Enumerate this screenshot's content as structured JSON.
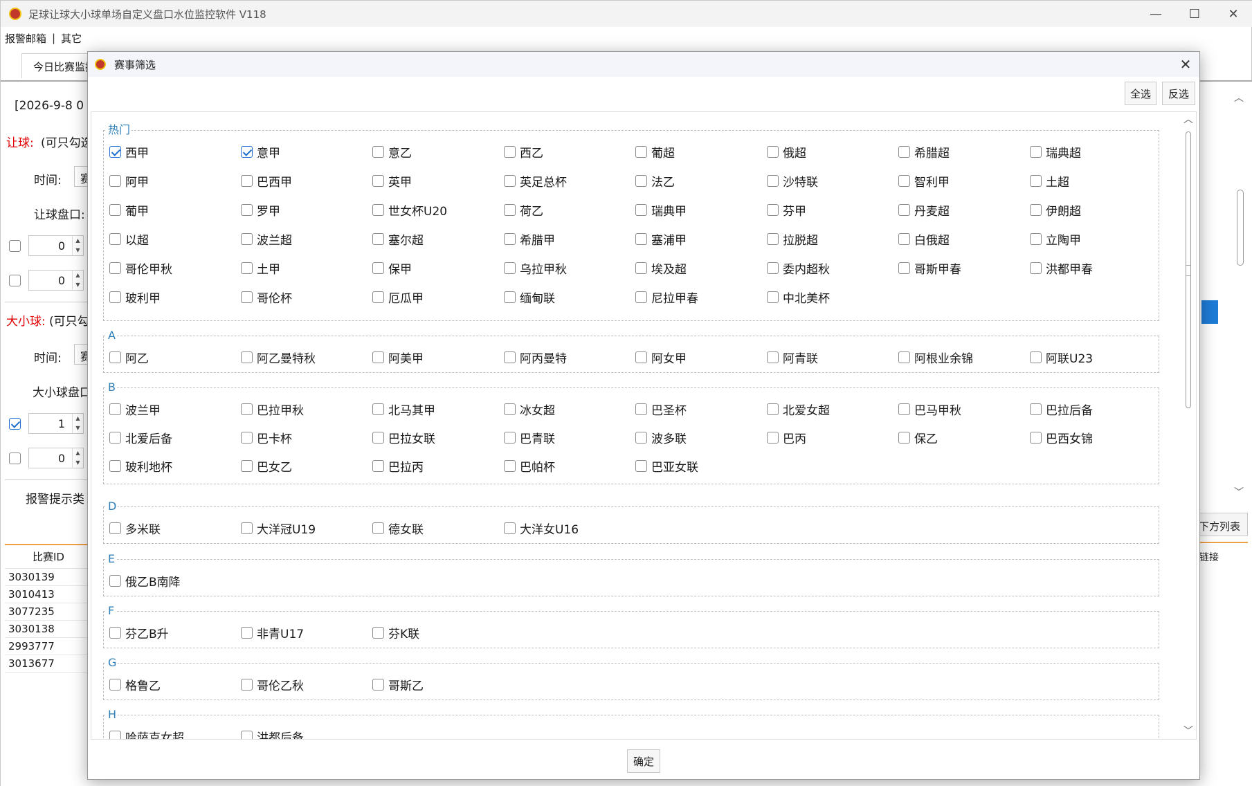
{
  "window": {
    "title": "足球让球大小球单场自定义盘口水位监控软件 V118",
    "minimize": "—",
    "maximize": "☐",
    "close": "✕"
  },
  "menu": {
    "items": [
      "报警邮箱",
      "其它"
    ],
    "separator": "|"
  },
  "tab": {
    "label": "今日比赛监控"
  },
  "background": {
    "date_label": "[2026-9-8 0",
    "handicap_title": "让球:",
    "handicap_hint": "(可只勾选",
    "time_label": "时间:",
    "handicap_line_label": "让球盘口:",
    "combo_text": "赛",
    "row_values": [
      "0",
      "0",
      "1",
      "0"
    ],
    "overunder_title": "大小球:",
    "overunder_hint": "(可只勾",
    "overunder_line_label": "大小球盘口",
    "alarm_label": "报警提示类",
    "right_button": "下方列表",
    "right_header": "链接",
    "table": {
      "header": "比赛ID",
      "rows": [
        "3030139",
        "3010413",
        "3077235",
        "3030138",
        "2993777",
        "3013677"
      ]
    }
  },
  "dialog": {
    "title": "赛事筛选",
    "close": "✕",
    "select_all": "全选",
    "invert": "反选",
    "ok": "确定",
    "groups": [
      {
        "title": "热门",
        "items": [
          {
            "label": "西甲",
            "checked": true
          },
          {
            "label": "意甲",
            "checked": true
          },
          {
            "label": "意乙",
            "checked": false
          },
          {
            "label": "西乙",
            "checked": false
          },
          {
            "label": "葡超",
            "checked": false
          },
          {
            "label": "俄超",
            "checked": false
          },
          {
            "label": "希腊超",
            "checked": false
          },
          {
            "label": "瑞典超",
            "checked": false
          },
          {
            "label": "阿甲",
            "checked": false
          },
          {
            "label": "巴西甲",
            "checked": false
          },
          {
            "label": "英甲",
            "checked": false
          },
          {
            "label": "英足总杯",
            "checked": false
          },
          {
            "label": "法乙",
            "checked": false
          },
          {
            "label": "沙特联",
            "checked": false
          },
          {
            "label": "智利甲",
            "checked": false
          },
          {
            "label": "土超",
            "checked": false
          },
          {
            "label": "葡甲",
            "checked": false
          },
          {
            "label": "罗甲",
            "checked": false
          },
          {
            "label": "世女杯U20",
            "checked": false
          },
          {
            "label": "荷乙",
            "checked": false
          },
          {
            "label": "瑞典甲",
            "checked": false
          },
          {
            "label": "芬甲",
            "checked": false
          },
          {
            "label": "丹麦超",
            "checked": false
          },
          {
            "label": "伊朗超",
            "checked": false
          },
          {
            "label": "以超",
            "checked": false
          },
          {
            "label": "波兰超",
            "checked": false
          },
          {
            "label": "塞尔超",
            "checked": false
          },
          {
            "label": "希腊甲",
            "checked": false
          },
          {
            "label": "塞浦甲",
            "checked": false
          },
          {
            "label": "拉脱超",
            "checked": false
          },
          {
            "label": "白俄超",
            "checked": false
          },
          {
            "label": "立陶甲",
            "checked": false
          },
          {
            "label": "哥伦甲秋",
            "checked": false
          },
          {
            "label": "土甲",
            "checked": false
          },
          {
            "label": "保甲",
            "checked": false
          },
          {
            "label": "乌拉甲秋",
            "checked": false
          },
          {
            "label": "埃及超",
            "checked": false
          },
          {
            "label": "委内超秋",
            "checked": false
          },
          {
            "label": "哥斯甲春",
            "checked": false
          },
          {
            "label": "洪都甲春",
            "checked": false
          },
          {
            "label": "玻利甲",
            "checked": false
          },
          {
            "label": "哥伦杯",
            "checked": false
          },
          {
            "label": "厄瓜甲",
            "checked": false
          },
          {
            "label": "缅甸联",
            "checked": false
          },
          {
            "label": "尼拉甲春",
            "checked": false
          },
          {
            "label": "中北美杯",
            "checked": false
          }
        ]
      },
      {
        "title": "A",
        "items": [
          {
            "label": "阿乙",
            "checked": false
          },
          {
            "label": "阿乙曼特秋",
            "checked": false
          },
          {
            "label": "阿美甲",
            "checked": false
          },
          {
            "label": "阿丙曼特",
            "checked": false
          },
          {
            "label": "阿女甲",
            "checked": false
          },
          {
            "label": "阿青联",
            "checked": false
          },
          {
            "label": "阿根业余锦",
            "checked": false
          },
          {
            "label": "阿联U23",
            "checked": false
          }
        ]
      },
      {
        "title": "B",
        "items": [
          {
            "label": "波兰甲",
            "checked": false
          },
          {
            "label": "巴拉甲秋",
            "checked": false
          },
          {
            "label": "北马其甲",
            "checked": false
          },
          {
            "label": "冰女超",
            "checked": false
          },
          {
            "label": "巴圣杯",
            "checked": false
          },
          {
            "label": "北爱女超",
            "checked": false
          },
          {
            "label": "巴马甲秋",
            "checked": false
          },
          {
            "label": "巴拉后备",
            "checked": false
          },
          {
            "label": "北爱后备",
            "checked": false
          },
          {
            "label": "巴卡杯",
            "checked": false
          },
          {
            "label": "巴拉女联",
            "checked": false
          },
          {
            "label": "巴青联",
            "checked": false
          },
          {
            "label": "波多联",
            "checked": false
          },
          {
            "label": "巴丙",
            "checked": false
          },
          {
            "label": "保乙",
            "checked": false
          },
          {
            "label": "巴西女锦",
            "checked": false
          },
          {
            "label": "玻利地杯",
            "checked": false
          },
          {
            "label": "巴女乙",
            "checked": false
          },
          {
            "label": "巴拉丙",
            "checked": false
          },
          {
            "label": "巴帕杯",
            "checked": false
          },
          {
            "label": "巴亚女联",
            "checked": false
          }
        ]
      },
      {
        "title": "D",
        "items": [
          {
            "label": "多米联",
            "checked": false
          },
          {
            "label": "大洋冠U19",
            "checked": false
          },
          {
            "label": "德女联",
            "checked": false
          },
          {
            "label": "大洋女U16",
            "checked": false
          }
        ]
      },
      {
        "title": "E",
        "items": [
          {
            "label": "俄乙B南降",
            "checked": false
          }
        ]
      },
      {
        "title": "F",
        "items": [
          {
            "label": "芬乙B升",
            "checked": false
          },
          {
            "label": "非青U17",
            "checked": false
          },
          {
            "label": "芬K联",
            "checked": false
          }
        ]
      },
      {
        "title": "G",
        "items": [
          {
            "label": "格鲁乙",
            "checked": false
          },
          {
            "label": "哥伦乙秋",
            "checked": false
          },
          {
            "label": "哥斯乙",
            "checked": false
          }
        ]
      },
      {
        "title": "H",
        "items": [
          {
            "label": "哈萨克女超",
            "checked": false
          },
          {
            "label": "洪都后备",
            "checked": false
          }
        ]
      }
    ]
  }
}
